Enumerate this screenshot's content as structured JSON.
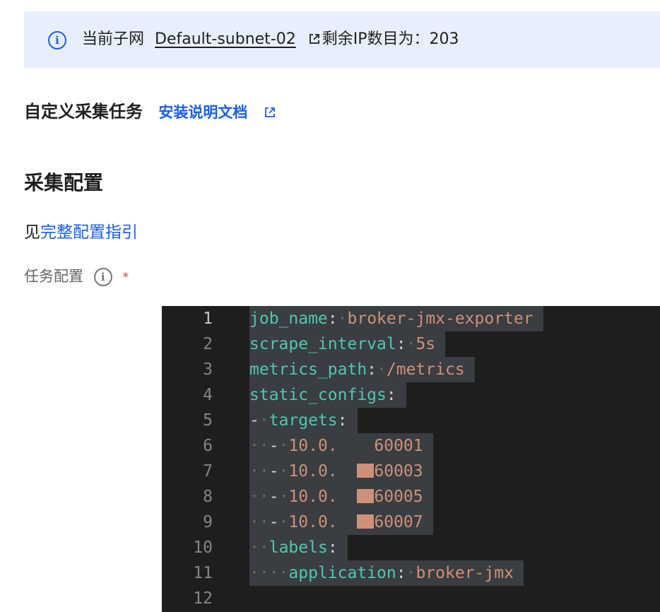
{
  "alert": {
    "prefix": "当前子网",
    "subnet_name": "Default-subnet-02",
    "suffix": "剩余IP数目为：203"
  },
  "task_header": {
    "title": "自定义采集任务",
    "doc_link": "安装说明文档"
  },
  "collect_section": {
    "title": "采集配置",
    "see_prefix": "见",
    "guide_link": "完整配置指引"
  },
  "task_config_field": {
    "label": "任务配置",
    "required_mark": "*"
  },
  "editor": {
    "line_numbers": [
      "1",
      "2",
      "3",
      "4",
      "5",
      "6",
      "7",
      "8",
      "9",
      "10",
      "11",
      "12"
    ],
    "lines": [
      {
        "indent": "",
        "dash": "",
        "key": "job_name",
        "value": "broker-jmx-exporter"
      },
      {
        "indent": "",
        "dash": "",
        "key": "scrape_interval",
        "value": "5s"
      },
      {
        "indent": "",
        "dash": "",
        "key": "metrics_path",
        "value": "/metrics"
      },
      {
        "indent": "",
        "dash": "",
        "key": "static_configs",
        "value": ""
      },
      {
        "indent": "",
        "dash": "-",
        "key": "targets",
        "value": ""
      },
      {
        "indent": "··",
        "dash": "-",
        "value_prefix": "10.0.",
        "value_suffix": "60001"
      },
      {
        "indent": "··",
        "dash": "-",
        "value_prefix": "10.0.",
        "value_suffix": "60003"
      },
      {
        "indent": "··",
        "dash": "-",
        "value_prefix": "10.0.",
        "value_suffix": "60005"
      },
      {
        "indent": "··",
        "dash": "-",
        "value_prefix": "10.0.",
        "value_suffix": "60007"
      },
      {
        "indent": "·",
        "dash": "",
        "key": "labels",
        "value": ""
      },
      {
        "indent": "···",
        "dash": "",
        "key": "application",
        "value": "broker-jmx"
      },
      {
        "indent": "",
        "dash": "",
        "key": "",
        "value": ""
      }
    ]
  },
  "colors": {
    "link": "#1a5ee8",
    "alert_bg": "#e8effc",
    "editor_bg": "#1e1e1e",
    "yaml_key": "#4ec9b0",
    "yaml_value": "#ce9178",
    "required": "#e54545"
  },
  "icons": {
    "alert": "info-circle-icon",
    "external": "external-link-icon",
    "field_help": "info-circle-icon"
  }
}
